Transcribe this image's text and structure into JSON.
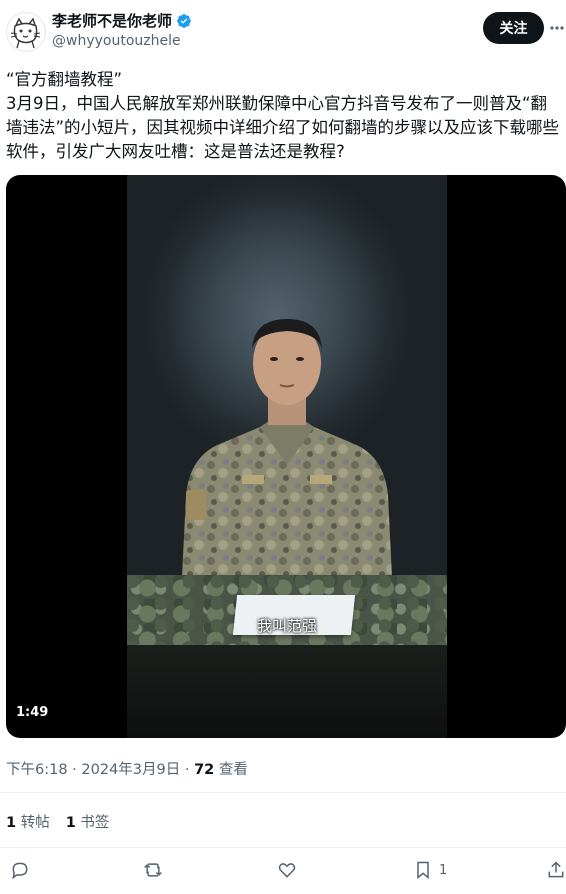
{
  "author": {
    "display_name": "李老师不是你老师",
    "handle": "@whyyoutouzhele",
    "verified": true
  },
  "follow_label": "关注",
  "more_icon": "more-horizontal-icon",
  "tweet": {
    "text": "“官方翻墙教程”\n3月9日，中国人民解放军郑州联勤保障中心官方抖音号发布了一则普及“翻墙违法”的小短片，因其视频中详细介绍了如何翻墙的步骤以及应该下载哪些软件，引发广大网友吐槽：这是普法还是教程?"
  },
  "video": {
    "subtitle": "我叫范强",
    "duration": "1:49"
  },
  "meta": {
    "time": "下午6:18",
    "separator": " · ",
    "date": "2024年3月9日",
    "views_count": "72",
    "views_label": " 查看"
  },
  "stats": {
    "retweets_count": "1",
    "retweets_label": "转帖",
    "bookmarks_count": "1",
    "bookmarks_label": "书签"
  },
  "actions": {
    "reply_icon": "reply-icon",
    "retweet_icon": "retweet-icon",
    "like_icon": "heart-icon",
    "bookmark_icon": "bookmark-icon",
    "bookmark_count": "1",
    "share_icon": "share-icon"
  },
  "colors": {
    "text_primary": "#0f1419",
    "text_secondary": "#536471",
    "verified_blue": "#1d9bf0",
    "button_dark": "#0f1419"
  }
}
